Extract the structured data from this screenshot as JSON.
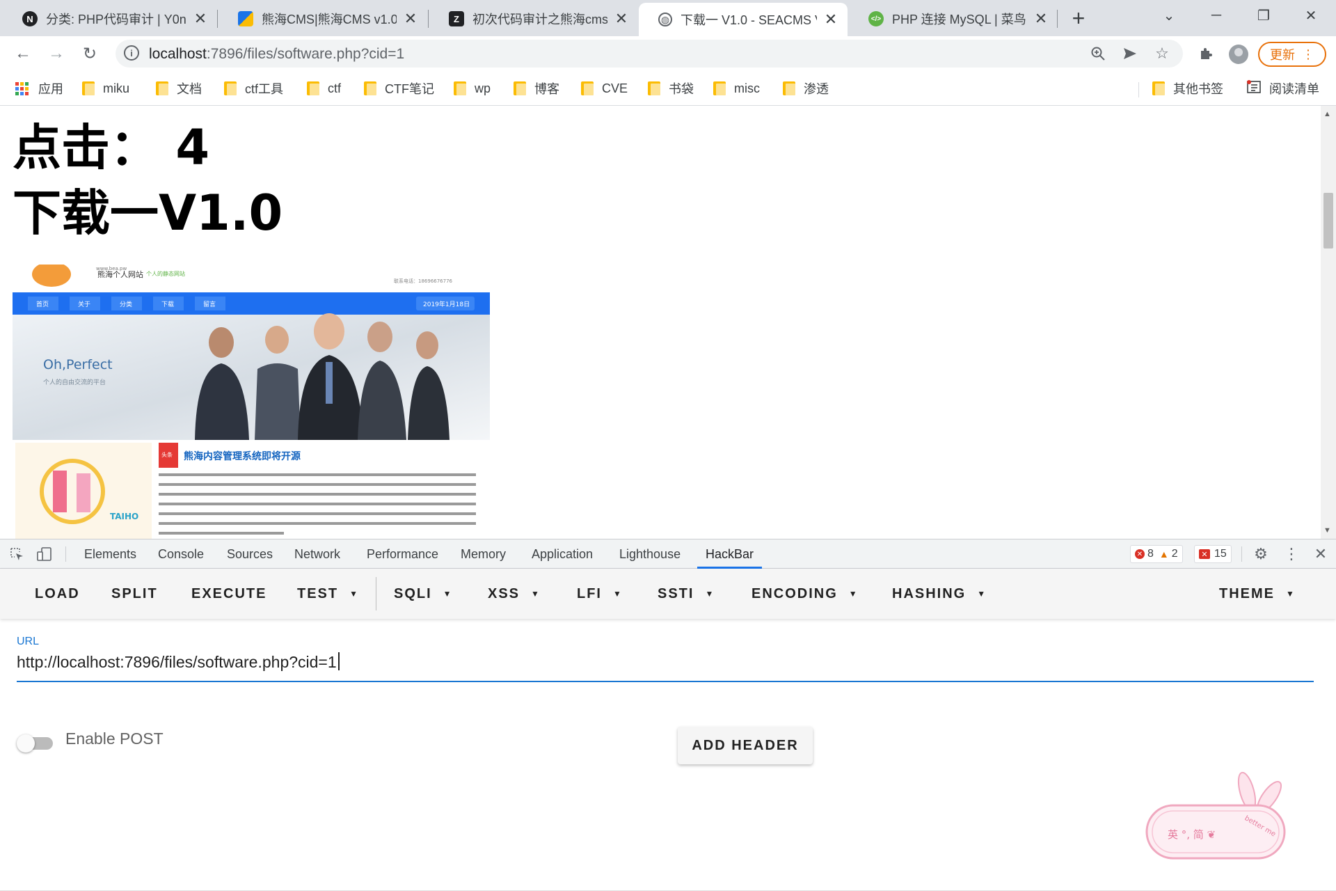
{
  "tabs": [
    {
      "label": "分类: PHP代码审计 | Y0n",
      "icon": "notion-icon",
      "favicon_text": "N",
      "favicon_color": "#202124",
      "active": false
    },
    {
      "label": "熊海CMS|熊海CMS v1.0",
      "icon": "xionghai-cms-icon",
      "favicon_text": "",
      "favicon_color": "#1a73e8",
      "active": false
    },
    {
      "label": "初次代码审计之熊海cms",
      "icon": "blog-icon",
      "favicon_text": "Z",
      "favicon_color": "#202124",
      "active": false
    },
    {
      "label": "下载一 V1.0 - SEACMS V",
      "icon": "globe-icon",
      "favicon_text": "",
      "favicon_color": "#5f6368",
      "active": true
    },
    {
      "label": "PHP 连接 MySQL | 菜鸟",
      "icon": "runoob-icon",
      "favicon_text": "",
      "favicon_color": "#5fb346",
      "active": false
    }
  ],
  "address_bar": {
    "host": "localhost",
    "rest": ":7896/files/software.php?cid=1"
  },
  "update_label": "更新",
  "bookmarks": {
    "apps_label": "应用",
    "items": [
      "miku",
      "文档",
      "ctf工具",
      "ctf",
      "CTF笔记",
      "wp",
      "博客",
      "CVE",
      "书袋",
      "misc",
      "渗透"
    ],
    "other_label": "其他书签",
    "reading_list_label": "阅读清单"
  },
  "page": {
    "clicks_line": "点击： 4",
    "title_line": "下载一V1.0",
    "preview": {
      "site_name": "熊海个人网站",
      "site_url": "www.bea.pw",
      "tagline": "个人的静态网站",
      "phone": "联系电话：18696676776",
      "nav_items": [
        "首页",
        "关于",
        "分类",
        "下载",
        "留言"
      ],
      "nav_date": "2019年1月18日",
      "hero_title": "Oh,Perfect",
      "hero_subtitle": "个人的自由交流的平台",
      "news_badge": "头条",
      "news_title": "熊海内容管理系统即将开源",
      "brand_text": "TAIHO",
      "colors": {
        "nav": "#1e6ff0",
        "logo": "#f39c3a",
        "badge": "#e53935",
        "news_title": "#1565c0"
      }
    }
  },
  "devtools": {
    "tabs": [
      "Elements",
      "Console",
      "Sources",
      "Network",
      "Performance",
      "Memory",
      "Application",
      "Lighthouse",
      "HackBar"
    ],
    "active_tab": "HackBar",
    "error_count": "8",
    "warning_count": "2",
    "issue_count": "15"
  },
  "hackbar": {
    "buttons": [
      {
        "label": "LOAD",
        "dropdown": false
      },
      {
        "label": "SPLIT",
        "dropdown": false
      },
      {
        "label": "EXECUTE",
        "dropdown": false
      },
      {
        "label": "TEST",
        "dropdown": true
      },
      {
        "label": "SQLI",
        "dropdown": true
      },
      {
        "label": "XSS",
        "dropdown": true
      },
      {
        "label": "LFI",
        "dropdown": true
      },
      {
        "label": "SSTI",
        "dropdown": true
      },
      {
        "label": "ENCODING",
        "dropdown": true
      },
      {
        "label": "HASHING",
        "dropdown": true
      }
    ],
    "theme_label": "THEME",
    "url_label": "URL",
    "url_value": "http://localhost:7896/files/software.php?cid=1",
    "enable_post_label": "Enable POST",
    "enable_post": false,
    "add_header_label": "ADD HEADER",
    "sticker_text": "英 °, 简 ❦",
    "sticker_note": "better me"
  },
  "colors": {
    "accent": "#1a73e8",
    "hackbar_accent": "#1976d2",
    "update": "#e8710a",
    "error": "#d93025",
    "warning": "#e37400"
  }
}
